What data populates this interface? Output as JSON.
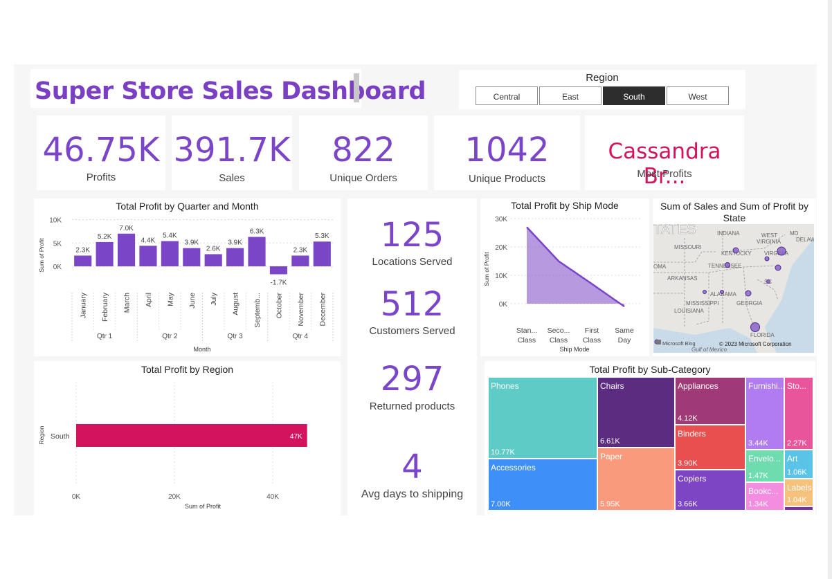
{
  "title": "Super Store Sales Dashboard",
  "slicer": {
    "label": "Region",
    "options": [
      "Central",
      "East",
      "South",
      "West"
    ],
    "selected": "South"
  },
  "kpis": [
    {
      "value": "46.75K",
      "label": "Profits"
    },
    {
      "value": "391.7K",
      "label": "Sales"
    },
    {
      "value": "822",
      "label": "Unique Orders"
    },
    {
      "value": "1042",
      "label": "Unique Products"
    },
    {
      "value": "Cassandra Br...",
      "label": "Most Profits"
    }
  ],
  "mid_stats": [
    {
      "value": "125",
      "label": "Locations Served"
    },
    {
      "value": "512",
      "label": "Customers Served"
    },
    {
      "value": "297",
      "label": "Returned products"
    },
    {
      "value": "4",
      "label": "Avg days to shipping"
    }
  ],
  "map": {
    "title": "Sum of Sales and Sum of Profit by State",
    "labels": [
      "TATES",
      "INDIANA",
      "MD",
      "WEST",
      "VIRGINIA",
      "DELAWA",
      "MISSOURI",
      "KENTUCKY",
      "VIRGINIA",
      "OMA",
      "TENNESSEE",
      "ARKANSAS",
      "SC",
      "ALABAMA",
      "GEORGIA",
      "MISSISSIPPI",
      "LOUISIANA",
      "FLORIDA",
      "Gulf of Mexico"
    ],
    "credit_left": "Microsoft Bing",
    "credit_right": "© 2023 Microsoft Corporation"
  },
  "chart_data": [
    {
      "type": "bar",
      "title": "Total Profit by Quarter and Month",
      "xlabel": "Month",
      "ylabel": "Sum of Profit",
      "categories": [
        "January",
        "February",
        "March",
        "April",
        "May",
        "June",
        "July",
        "August",
        "Septemb...",
        "October",
        "November",
        "December"
      ],
      "quarters": [
        "Qtr 1",
        "Qtr 2",
        "Qtr 3",
        "Qtr 4"
      ],
      "values": [
        2.3,
        5.2,
        7.0,
        4.4,
        5.4,
        3.9,
        2.6,
        3.9,
        6.3,
        -1.7,
        2.3,
        5.3
      ],
      "value_labels": [
        "2.3K",
        "5.2K",
        "7.0K",
        "4.4K",
        "5.4K",
        "3.9K",
        "2.6K",
        "3.9K",
        "6.3K",
        "-1.7K",
        "2.3K",
        "5.3K"
      ],
      "yticks": [
        "10K",
        "5K",
        "0K"
      ],
      "ylim": [
        -2.5,
        10
      ],
      "unit": "thousands",
      "color": "#7b45c7"
    },
    {
      "type": "area",
      "title": "Total Profit by Ship Mode",
      "xlabel": "Ship Mode",
      "ylabel": "Sum of Profit",
      "categories": [
        "Stan... Class",
        "Seco... Class",
        "First Class",
        "Same Day"
      ],
      "values": [
        27,
        15,
        7,
        -1
      ],
      "yticks": [
        "30K",
        "20K",
        "10K",
        "0K"
      ],
      "ylim": [
        -2,
        30
      ],
      "unit": "thousands",
      "color": "#7b45c7"
    },
    {
      "type": "bar",
      "title": "Total Profit by Region",
      "xlabel": "Sum of Profit",
      "ylabel": "Region",
      "categories": [
        "South"
      ],
      "values": [
        47
      ],
      "value_labels": [
        "47K"
      ],
      "xticks": [
        "0K",
        "20K",
        "40K"
      ],
      "xlim": [
        0,
        52
      ],
      "unit": "thousands",
      "color": "#d3135e"
    },
    {
      "type": "treemap",
      "title": "Total Profit by Sub-Category",
      "items": [
        {
          "name": "Phones",
          "value_label": "10.77K",
          "color": "#5ecbc7"
        },
        {
          "name": "Accessories",
          "value_label": "7.00K",
          "color": "#3e8ff7"
        },
        {
          "name": "Chairs",
          "value_label": "6.61K",
          "color": "#5c2c80"
        },
        {
          "name": "Paper",
          "value_label": "5.95K",
          "color": "#fa9a7d"
        },
        {
          "name": "Appliances",
          "value_label": "4.12K",
          "color": "#a03a77"
        },
        {
          "name": "Binders",
          "value_label": "3.90K",
          "color": "#e8504f"
        },
        {
          "name": "Copiers",
          "value_label": "3.66K",
          "color": "#7d45c4"
        },
        {
          "name": "Furnishi...",
          "value_label": "3.44K",
          "color": "#b07cf0"
        },
        {
          "name": "Sto...",
          "value_label": "2.27K",
          "color": "#e9559b"
        },
        {
          "name": "Envelo...",
          "value_label": "1.47K",
          "color": "#6fdcb0"
        },
        {
          "name": "Art",
          "value_label": "1.06K",
          "color": "#5cc3e8"
        },
        {
          "name": "Bookc...",
          "value_label": "1.34K",
          "color": "#f38de0"
        },
        {
          "name": "Labels",
          "value_label": "1.04K",
          "color": "#f6c27b"
        }
      ]
    }
  ]
}
